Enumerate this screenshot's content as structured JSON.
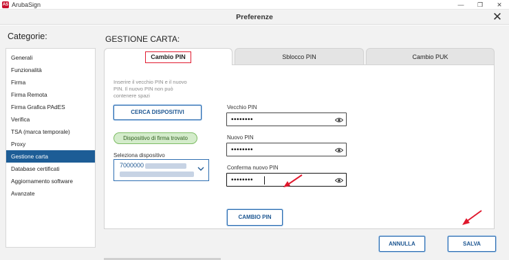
{
  "titlebar": {
    "app_name": "ArubaSign",
    "logo_text": "AS",
    "minimize_glyph": "—",
    "maximize_glyph": "❐",
    "close_glyph": "✕"
  },
  "dialog": {
    "title": "Preferenze",
    "close_glyph": "✕"
  },
  "sidebar": {
    "title": "Categorie:",
    "items": [
      {
        "label": "Generali",
        "active": false
      },
      {
        "label": "Funzionalità",
        "active": false
      },
      {
        "label": "Firma",
        "active": false
      },
      {
        "label": "Firma Remota",
        "active": false
      },
      {
        "label": "Firma Grafica PAdES",
        "active": false
      },
      {
        "label": "Verifica",
        "active": false
      },
      {
        "label": "TSA (marca temporale)",
        "active": false
      },
      {
        "label": "Proxy",
        "active": false
      },
      {
        "label": "Gestione carta",
        "active": true
      },
      {
        "label": "Database certificati",
        "active": false
      },
      {
        "label": "Aggiornamento software",
        "active": false
      },
      {
        "label": "Avanzate",
        "active": false
      }
    ]
  },
  "main": {
    "section_title": "GESTIONE CARTA:",
    "tabs": [
      {
        "label": "Cambio PIN",
        "active": true
      },
      {
        "label": "Sblocco PIN",
        "active": false
      },
      {
        "label": "Cambio PUK",
        "active": false
      }
    ],
    "info_text": "Inserire il vecchio PIN e il nuovo PIN. Il nuovo PIN non può contenere spazi",
    "search_button": "CERCA DISPOSITIVI",
    "device_status": "Dispositivo di firma trovato",
    "device_select": {
      "label": "Seleziona dispositivo",
      "value_visible": "7000000"
    },
    "fields": [
      {
        "label": "Vecchio PIN",
        "value": "••••••••"
      },
      {
        "label": "Nuovo PIN",
        "value": "••••••••"
      },
      {
        "label": "Conferma nuovo PIN",
        "value": "••••••••"
      }
    ],
    "change_button": "CAMBIO PIN"
  },
  "footer": {
    "cancel_button": "ANNULLA",
    "save_button": "SALVA"
  },
  "colors": {
    "accent": "#1d5d96",
    "button_border": "#2b6cb0",
    "highlight_red": "#e0182d",
    "status_green": "#d4eccb",
    "panel_bg": "#f2f2f2"
  },
  "icons": {
    "app_logo": "arubasign-logo-icon",
    "eye": "eye-icon",
    "chevron": "chevron-down-icon",
    "arrow": "red-arrow-icon"
  }
}
